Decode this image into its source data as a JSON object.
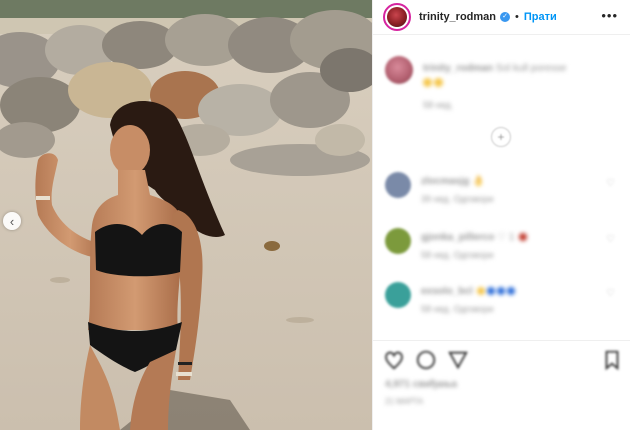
{
  "photo": {
    "description_icon": "beach-photo",
    "prev_arrow": "‹"
  },
  "header": {
    "username": "trinity_rodman",
    "verified_mark": "✓",
    "separator": "•",
    "follow_label": "Прати",
    "more_label": "•••"
  },
  "caption": {
    "username": "trinity_rodman",
    "text": "Sol kull poresse",
    "meta": "58 нед."
  },
  "load_more_icon": "+",
  "comments": [
    {
      "username": "zlocmasjg",
      "text": "👌",
      "meta": "39 нед.   Одговори",
      "avatar_color": "#7a8aa8"
    },
    {
      "username": "gjonka_pillerco",
      "text": "♡ 1",
      "meta": "58 нед.   Одговори",
      "avatar_color": "#7c9a3c"
    },
    {
      "username": "exsolo_bcl",
      "text": "",
      "meta": "58 нед.   Одговори",
      "avatar_color": "#3aa09a"
    }
  ],
  "likes": "4,971 свиђања",
  "timestamp": "21 МАРТА"
}
